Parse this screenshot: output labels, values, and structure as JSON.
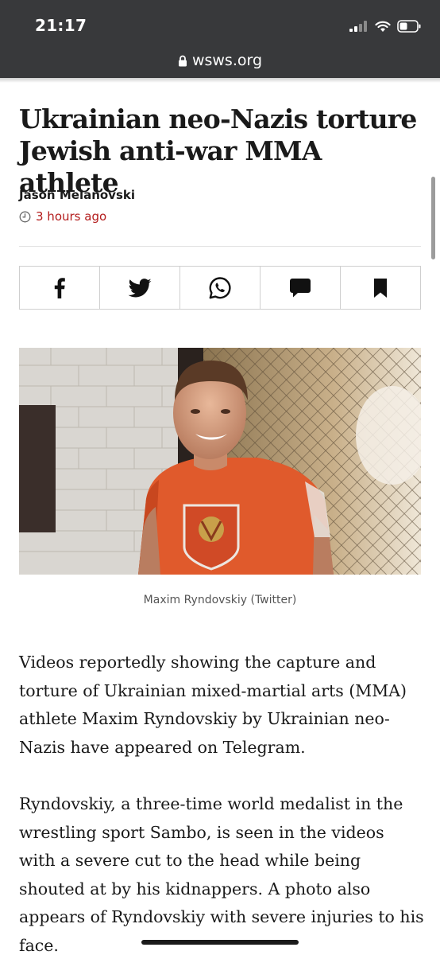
{
  "status_bar": {
    "time": "21:17",
    "icons": [
      "signal-icon",
      "wifi-icon",
      "battery-icon"
    ]
  },
  "browser": {
    "url": "wsws.org",
    "lock_icon": "lock-icon"
  },
  "article": {
    "headline": "Ukrainian neo-Nazis torture Jewish anti-war MMA athlete",
    "author": "Jason Melanovski",
    "timestamp": "3 hours ago",
    "accent_color": "#b31b1b"
  },
  "share_bar": {
    "buttons": [
      "facebook-icon",
      "twitter-icon",
      "whatsapp-icon",
      "comment-icon",
      "bookmark-icon"
    ]
  },
  "photo": {
    "caption": "Maxim Ryndovskiy (Twitter)"
  },
  "paragraphs": [
    "Videos reportedly showing the capture and torture of Ukrainian mixed-martial arts (MMA) athlete Maxim Ryndovskiy by Ukrainian neo-Nazis have appeared on Telegram.",
    "Ryndovskiy, a three-time world medalist in the wrestling sport Sambo, is seen in the videos with a severe cut to the head while being shouted at by his kidnappers. A photo also appears of Ryndovskiy with severe injuries to his face."
  ]
}
